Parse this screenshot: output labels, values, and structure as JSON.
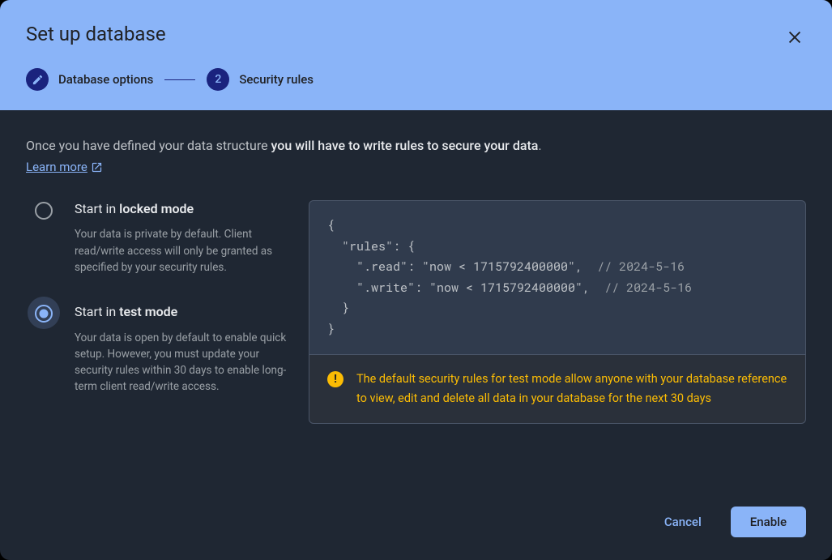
{
  "dialog": {
    "title": "Set up database",
    "stepper": {
      "step1": {
        "label": "Database options"
      },
      "step2": {
        "number": "2",
        "label": "Security rules"
      }
    },
    "intro": {
      "prefix": "Once you have defined your data structure ",
      "bold": "you will have to write rules to secure your data",
      "suffix": "."
    },
    "learn_more": "Learn more",
    "options": {
      "locked": {
        "title_prefix": "Start in ",
        "title_bold": "locked mode",
        "desc": "Your data is private by default. Client read/write access will only be granted as specified by your security rules."
      },
      "test": {
        "title_prefix": "Start in ",
        "title_bold": "test mode",
        "desc": "Your data is open by default to enable quick setup. However, you must update your security rules within 30 days to enable long-term client read/write access."
      }
    },
    "code": {
      "l1": "{",
      "l2": "  \"rules\": {",
      "l3a": "    \".read\": \"now < 1715792400000\",  ",
      "l3b": "// 2024-5-16",
      "l4a": "    \".write\": \"now < 1715792400000\",  ",
      "l4b": "// 2024-5-16",
      "l5": "  }",
      "l6": "}"
    },
    "warning": "The default security rules for test mode allow anyone with your database reference to view, edit and delete all data in your database for the next 30 days",
    "warning_glyph": "!",
    "footer": {
      "cancel": "Cancel",
      "enable": "Enable"
    }
  }
}
